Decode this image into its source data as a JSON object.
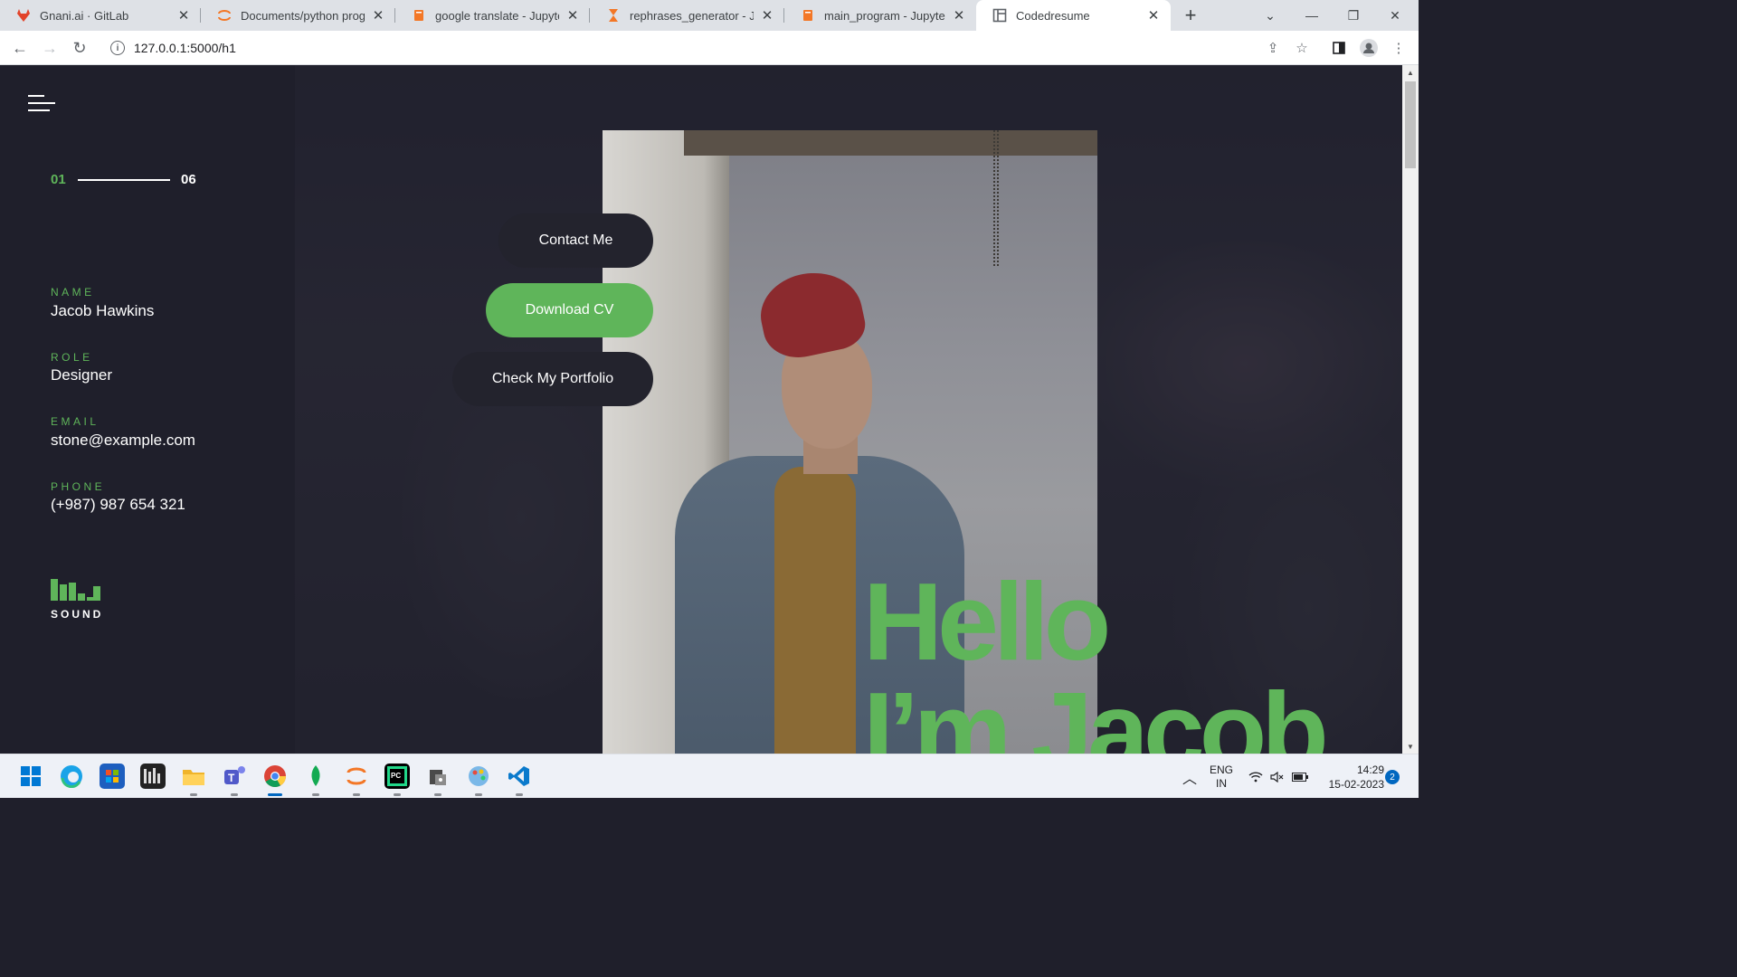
{
  "browser": {
    "tabs": [
      {
        "title": "Gnani.ai · GitLab",
        "icon": "gitlab-icon",
        "color": "#e24329"
      },
      {
        "title": "Documents/python progra",
        "icon": "jupyter-icon",
        "color": "#f37726"
      },
      {
        "title": "google translate - Jupyter N",
        "icon": "notebook-icon",
        "color": "#f37726"
      },
      {
        "title": "rephrases_generator - Jupy",
        "icon": "hourglass-icon",
        "color": "#f37726"
      },
      {
        "title": "main_program - Jupyter No",
        "icon": "notebook-icon",
        "color": "#f37726"
      },
      {
        "title": "Codedresume",
        "icon": "layout-icon",
        "color": "#5f6368"
      }
    ],
    "url": "127.0.0.1:5000/h1"
  },
  "sidebar": {
    "counter_current": "01",
    "counter_total": "06",
    "name_label": "NAME",
    "name_value": "Jacob Hawkins",
    "role_label": "ROLE",
    "role_value": "Designer",
    "email_label": "EMAIL",
    "email_value": "stone@example.com",
    "phone_label": "PHONE",
    "phone_value": "(+987) 987 654 321",
    "sound_label": "SOUND"
  },
  "hero": {
    "buttons": {
      "contact": "Contact Me",
      "download": "Download CV",
      "portfolio": "Check My Portfolio"
    },
    "headline_line1": "Hello",
    "headline_line2": "I’m Jacob"
  },
  "colors": {
    "accent": "#5fb55a",
    "sidebar_bg": "#1f1f2b",
    "pill_dark": "#23232d"
  },
  "taskbar": {
    "apps": [
      "windows-start-icon",
      "edge-icon",
      "store-icon",
      "media-app-icon",
      "file-explorer-icon",
      "teams-icon",
      "chrome-icon",
      "mongodb-icon",
      "jupyter-icon",
      "pycharm-icon",
      "security-app-icon",
      "paint-icon",
      "vscode-icon"
    ],
    "lang_line1": "ENG",
    "lang_line2": "IN",
    "time": "14:29",
    "date": "15-02-2023",
    "notifications": "2"
  }
}
